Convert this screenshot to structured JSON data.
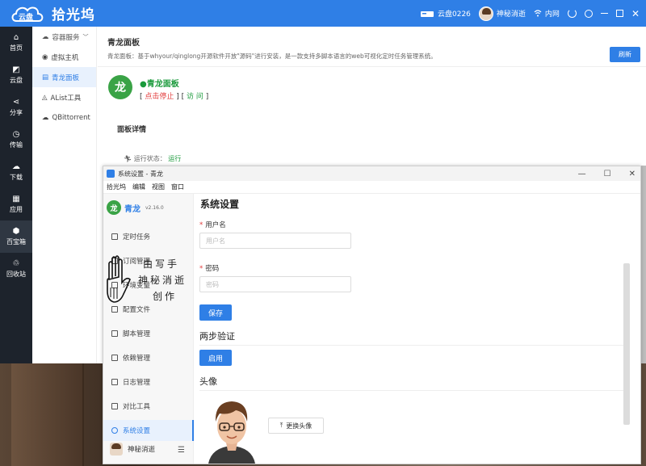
{
  "header": {
    "brand_cloud": "云盘",
    "brand_title": "拾光坞",
    "disk_label": "云盘0226",
    "user_name": "神秘消逝",
    "network": "内网",
    "accent": "#2f7fe6"
  },
  "leftnav": [
    {
      "label": "首页",
      "icon": "home-icon"
    },
    {
      "label": "云盘",
      "icon": "cloud-drive-icon"
    },
    {
      "label": "分享",
      "icon": "share-icon"
    },
    {
      "label": "传输",
      "icon": "transfer-icon"
    },
    {
      "label": "下载",
      "icon": "download-icon"
    },
    {
      "label": "应用",
      "icon": "apps-icon"
    },
    {
      "label": "百宝箱",
      "icon": "toolbox-icon"
    },
    {
      "label": "回收站",
      "icon": "recycle-icon"
    }
  ],
  "subnav": [
    {
      "label": "容器服务",
      "icon": "container-icon"
    },
    {
      "label": "虚拟主机",
      "icon": "vm-icon"
    },
    {
      "label": "青龙面板",
      "icon": "panel-icon"
    },
    {
      "label": "AList工具",
      "icon": "alist-icon"
    },
    {
      "label": "QBittorrent",
      "icon": "qbit-icon"
    }
  ],
  "main": {
    "title": "青龙面板",
    "description": "青龙面板：基于whyour/qinglong开源软件开放\"源码\"进行安装，是一款支持多脚本语言的web可视化定时任务管理系统。",
    "refresh_label": "刷新",
    "panel_name": "青龙面板",
    "action_stop": "点击停止",
    "action_visit": "访 问",
    "detail_title": "面板详情",
    "status_label": "运行状态：",
    "status_value": "运行"
  },
  "window": {
    "title": "系统设置 - 青龙",
    "menus": [
      "拾光坞",
      "编辑",
      "视图",
      "窗口"
    ],
    "app_name": "青龙",
    "version": "v2.16.0",
    "nav": [
      {
        "label": "定时任务"
      },
      {
        "label": "订阅管理"
      },
      {
        "label": "环境变量"
      },
      {
        "label": "配置文件"
      },
      {
        "label": "脚本管理"
      },
      {
        "label": "依赖管理"
      },
      {
        "label": "日志管理"
      },
      {
        "label": "对比工具"
      },
      {
        "label": "系统设置"
      }
    ],
    "user_name": "神秘消逝",
    "page_title": "系统设置",
    "username_label": "用户名",
    "username_placeholder": "用户名",
    "password_label": "密码",
    "password_placeholder": "密码",
    "save_label": "保存",
    "twofa_title": "两步验证",
    "enable_label": "启用",
    "avatar_title": "头像",
    "upload_label": "更换头像"
  },
  "watermark": {
    "line1": "由写手",
    "line2": "神秘消逝",
    "line3": "创作"
  }
}
